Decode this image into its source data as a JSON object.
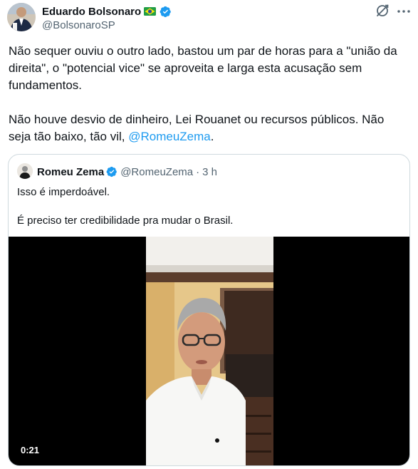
{
  "author": {
    "name": "Eduardo Bolsonaro",
    "handle": "@BolsonaroSP",
    "flag_icon": "brazil-flag-icon",
    "verified_icon": "verified-badge-icon"
  },
  "tweet": {
    "paragraph1": "Não sequer ouviu o outro lado, bastou um par de horas para a \"união da direita\", o \"potencial vice\" se aproveita e larga esta acusação sem fundamentos.",
    "paragraph2_text": "Não houve desvio de dinheiro, Lei Rouanet ou recursos públicos. Não seja tão baixo, tão vil, ",
    "paragraph2_mention": "@RomeuZema",
    "paragraph2_end": "."
  },
  "quote": {
    "name": "Romeu Zema",
    "handle": "@RomeuZema",
    "separator": "·",
    "time": "3 h",
    "line1": "Isso é imperdoável.",
    "line2": "É preciso ter credibilidade pra mudar o Brasil.",
    "video": {
      "duration": "0:21"
    }
  },
  "colors": {
    "text": "#0f1419",
    "secondary": "#536471",
    "link": "#1d9bf0",
    "border": "#cfd9de",
    "verified": "#1d9bf0"
  }
}
